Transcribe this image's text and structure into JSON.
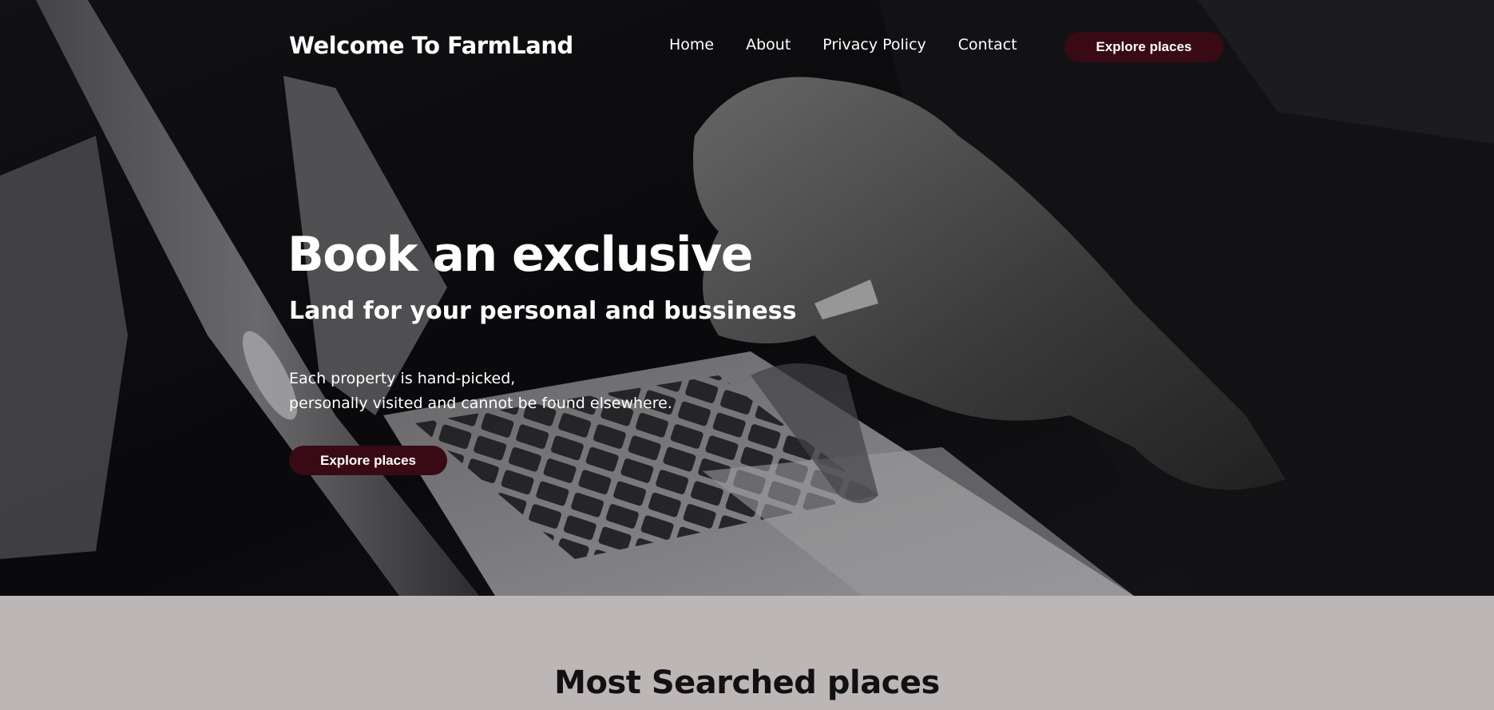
{
  "colors": {
    "accent": "#3a0a14",
    "section_background": "#bcb6b6",
    "hero_overlay": "#0b0b0d",
    "text_light": "#ffffff",
    "text_dark": "#111111"
  },
  "nav": {
    "brand": "Welcome To FarmLand",
    "links": [
      {
        "label": "Home"
      },
      {
        "label": "About"
      },
      {
        "label": "Privacy Policy"
      },
      {
        "label": "Contact"
      }
    ],
    "cta_label": "Explore places"
  },
  "hero": {
    "background_image": "laptop-hands-photo",
    "title": "Book an exclusive",
    "subtitle": "Land for your personal and bussiness",
    "description_lines": [
      "Each property is hand-picked,",
      "personally visited and cannot be found elsewhere."
    ],
    "cta_label": "Explore places"
  },
  "most_searched": {
    "title": "Most Searched places"
  }
}
